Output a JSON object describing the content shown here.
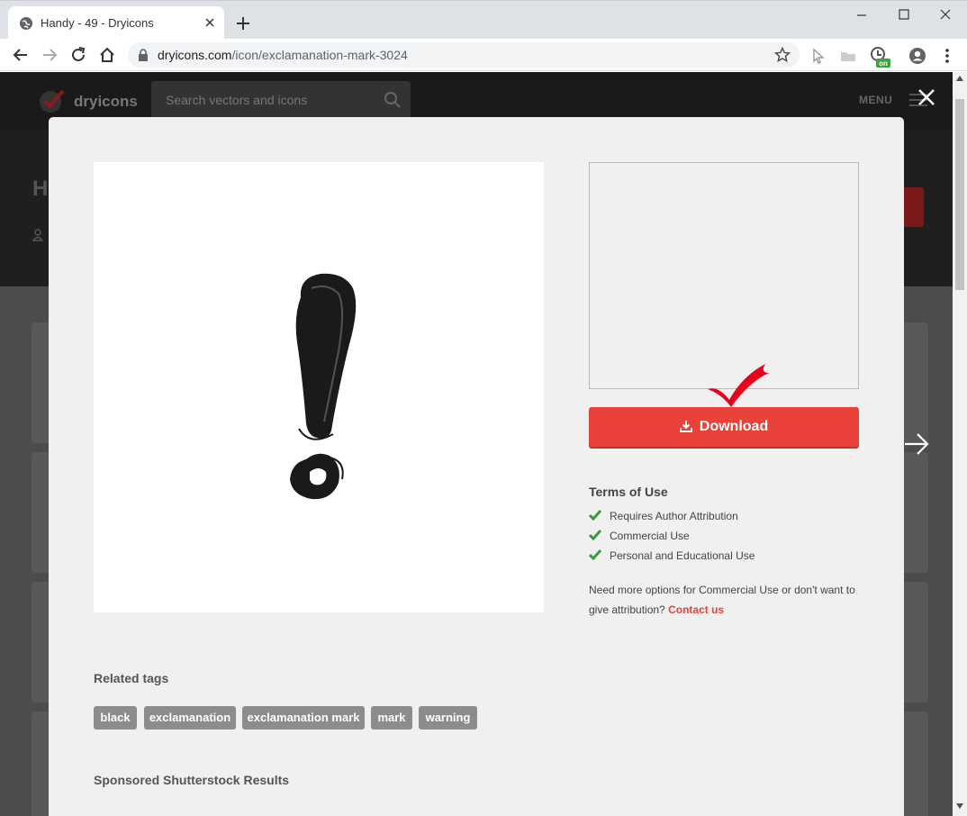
{
  "browser": {
    "tab_title": "Handy - 49 - Dryicons",
    "url_host": "dryicons.com",
    "url_path": "/icon/exclamanation-mark-3024",
    "extension_badge": "on"
  },
  "site": {
    "logo_text": "dryicons",
    "search_placeholder": "Search vectors and icons",
    "menu_label": "MENU",
    "hero_heading_partial": "H"
  },
  "modal": {
    "download_label": "Download",
    "terms_title": "Terms of Use",
    "terms": [
      "Requires Author Attribution",
      "Commercial Use",
      "Personal and Educational Use"
    ],
    "note_text": "Need more options for Commercial Use or don't want to give attribution?",
    "contact_label": "Contact us",
    "related_title": "Related tags",
    "tags": [
      "black",
      "exclamanation",
      "exclamanation mark",
      "mark",
      "warning"
    ],
    "sponsored_title": "Sponsored Shutterstock Results"
  },
  "colors": {
    "accent": "#e8423a",
    "check_green": "#3a9a3a",
    "tag_bg": "#8c8c8c"
  }
}
